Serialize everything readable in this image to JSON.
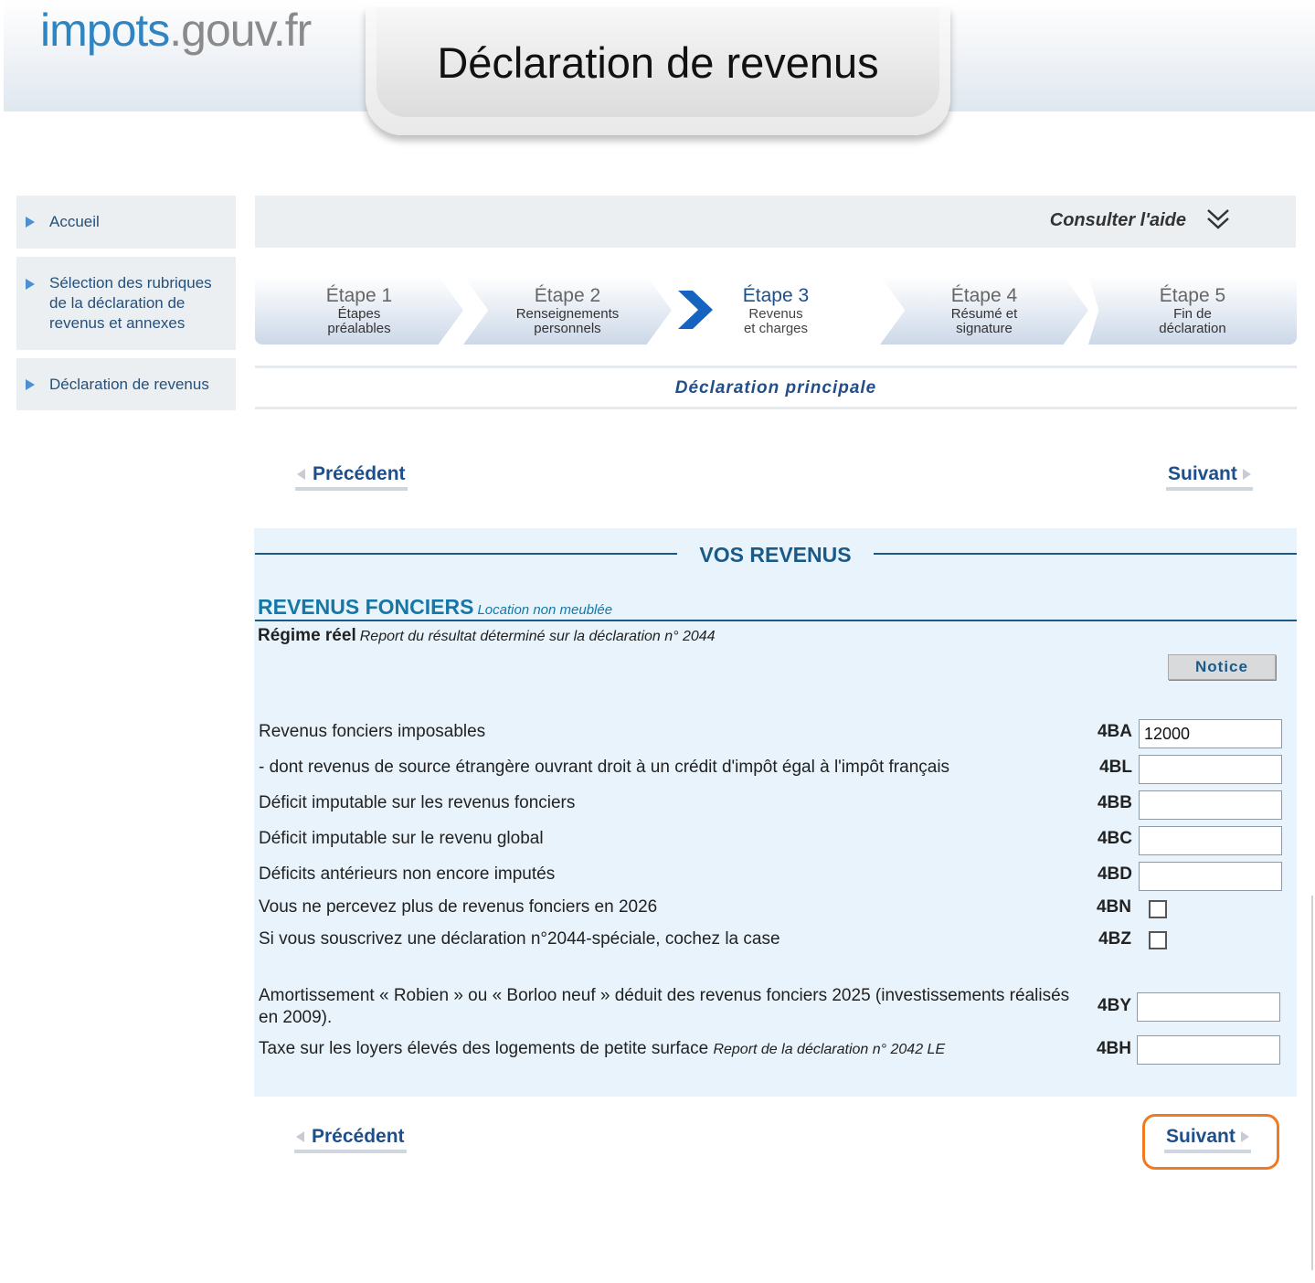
{
  "header": {
    "logo_part1": "impots",
    "logo_part2": ".gouv.fr",
    "title": "Déclaration de revenus"
  },
  "sidebar": {
    "items": [
      {
        "label": "Accueil"
      },
      {
        "label": "Sélection des rubriques de la déclaration de revenus et annexes"
      },
      {
        "label": "Déclaration de revenus"
      }
    ]
  },
  "help": {
    "label": "Consulter l'aide",
    "icon": "double-chevron-down-icon"
  },
  "steps": [
    {
      "title_word": "Étape",
      "number": "1",
      "line1": "Étapes",
      "line2": "préalables"
    },
    {
      "title_word": "Étape",
      "number": "2",
      "line1": "Renseignements",
      "line2": "personnels"
    },
    {
      "title_word": "Étape",
      "number": "3",
      "line1": "Revenus",
      "line2": "et charges"
    },
    {
      "title_word": "Étape",
      "number": "4",
      "line1": "Résumé et",
      "line2": "signature"
    },
    {
      "title_word": "Étape",
      "number": "5",
      "line1": "Fin de",
      "line2": "déclaration"
    }
  ],
  "active_step": 3,
  "declaration_label": "Déclaration principale",
  "nav": {
    "previous": "Précédent",
    "next": "Suivant"
  },
  "section": {
    "title": "VOS REVENUS",
    "subsection_title": "REVENUS FONCIERS",
    "subsection_subtitle": "Location non meublée",
    "regime_title": "Régime réel",
    "regime_subtitle": "Report du résultat déterminé sur la déclaration n° 2044",
    "notice_label": "Notice"
  },
  "rows": [
    {
      "label": "Revenus fonciers imposables",
      "code": "4BA",
      "type": "text",
      "value": "12000"
    },
    {
      "label": "- dont revenus de source étrangère ouvrant droit à un crédit d'impôt égal à l'impôt français",
      "code": "4BL",
      "type": "text",
      "value": ""
    },
    {
      "label": "Déficit imputable sur les revenus fonciers",
      "code": "4BB",
      "type": "text",
      "value": ""
    },
    {
      "label": "Déficit imputable sur le revenu global",
      "code": "4BC",
      "type": "text",
      "value": ""
    },
    {
      "label": "Déficits antérieurs non encore imputés",
      "code": "4BD",
      "type": "text",
      "value": ""
    },
    {
      "label": "Vous ne percevez plus de revenus fonciers en 2026",
      "code": "4BN",
      "type": "checkbox",
      "checked": false
    },
    {
      "label": "Si vous souscrivez une déclaration n°2044-spéciale, cochez la case",
      "code": "4BZ",
      "type": "checkbox",
      "checked": false
    },
    {
      "label": "Amortissement « Robien » ou « Borloo neuf » déduit des revenus fonciers 2025 (investissements réalisés en 2009).",
      "code": "4BY",
      "type": "text",
      "value": ""
    },
    {
      "label": "Taxe sur les loyers élevés des logements de petite surface",
      "label_note": "Report de la déclaration n° 2042 LE",
      "code": "4BH",
      "type": "text",
      "value": ""
    }
  ],
  "colors": {
    "brand_blue": "#2f85c1",
    "section_blue": "#1b5a87",
    "panel_bg": "#e8f3fb",
    "highlight": "#f07a22"
  }
}
